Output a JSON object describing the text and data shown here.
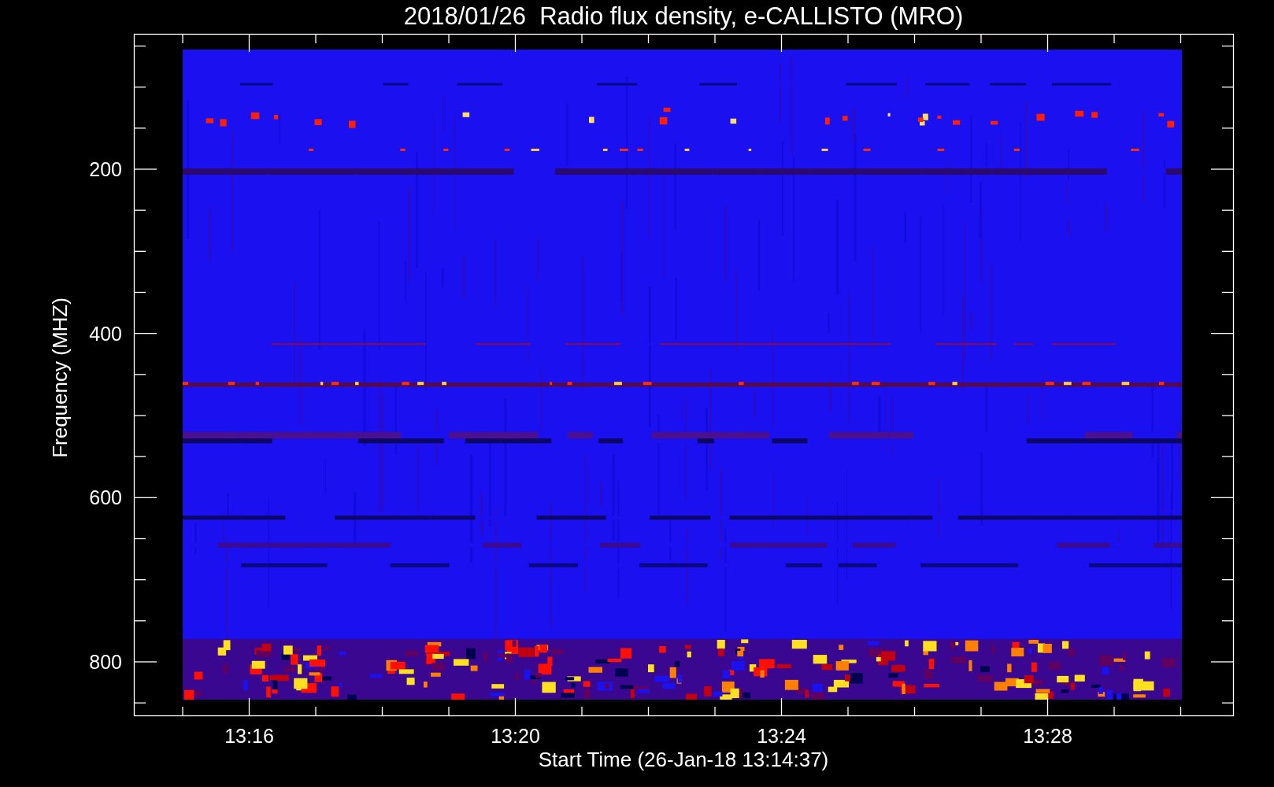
{
  "plot": {
    "title": "2018/01/26  Radio flux density, e-CALLISTO (MRO)",
    "y_axis": {
      "label": "Frequency (MHZ)",
      "ticks": [
        "200",
        "400",
        "600",
        "800"
      ]
    },
    "x_axis": {
      "label": "Start Time (26-Jan-18 13:14:37)",
      "ticks": [
        "13:16",
        "13:20",
        "13:24",
        "13:28"
      ]
    }
  }
}
